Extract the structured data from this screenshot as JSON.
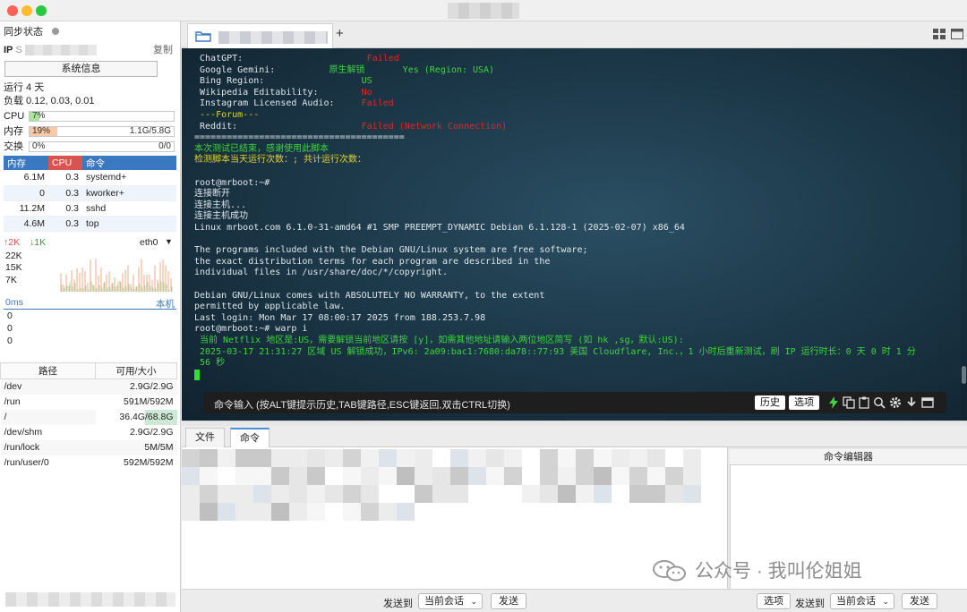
{
  "sidebar": {
    "sync_label": "同步状态",
    "ip_label": "IP",
    "ip_value_prefix": "S",
    "copy_label": "复制",
    "sysinfo_button": "系统信息",
    "uptime": "运行 4 天",
    "load": "负载 0.12, 0.03, 0.01",
    "cpu": {
      "label": "CPU",
      "percent_text": "7%",
      "fraction": 0.07,
      "value": ""
    },
    "mem": {
      "label": "内存",
      "percent_text": "19%",
      "fraction": 0.19,
      "value": "1.1G/5.8G"
    },
    "swap": {
      "label": "交换",
      "percent_text": "0%",
      "fraction": 0.0,
      "value": "0/0"
    },
    "proc_headers": {
      "mem": "内存",
      "cpu": "CPU",
      "cmd": "命令"
    },
    "processes": [
      {
        "mem": "6.1M",
        "cpu": "0.3",
        "cmd": "systemd+"
      },
      {
        "mem": "0",
        "cpu": "0.3",
        "cmd": "kworker+"
      },
      {
        "mem": "11.2M",
        "cpu": "0.3",
        "cmd": "sshd"
      },
      {
        "mem": "4.6M",
        "cpu": "0.3",
        "cmd": "top"
      }
    ],
    "net": {
      "up": "2K",
      "down": "1K",
      "iface": "eth0",
      "ticks": [
        "22K",
        "15K",
        "7K"
      ]
    },
    "latency": {
      "label": "0ms",
      "host": "本机",
      "values": [
        "0",
        "0",
        "0"
      ]
    },
    "disk_headers": {
      "path": "路径",
      "usage": "可用/大小"
    },
    "disks": [
      {
        "path": "/dev",
        "usage": "2.9G/2.9G"
      },
      {
        "path": "/run",
        "usage": "591M/592M"
      },
      {
        "path": "/",
        "usage": "36.4G/68.8G"
      },
      {
        "path": "/dev/shm",
        "usage": "2.9G/2.9G"
      },
      {
        "path": "/run/lock",
        "usage": "5M/5M"
      },
      {
        "path": "/run/user/0",
        "usage": "592M/592M"
      }
    ]
  },
  "tabs": {
    "add": "+",
    "close": "×"
  },
  "terminal": {
    "lines": [
      {
        "t": " ChatGPT:                       ",
        "r": "Failed",
        "rc": "red"
      },
      {
        "t": " Google Gemini:          ",
        "m": "原生解锁",
        "mc": "green",
        "t2": "       ",
        "r": "Yes (Region: USA)",
        "rc": "green"
      },
      {
        "t": " Bing Region:                  ",
        "r": "US",
        "rc": "green"
      },
      {
        "t": " Wikipedia Editability:        ",
        "r": "No",
        "rc": "red"
      },
      {
        "t": " Instagram Licensed Audio:     ",
        "r": "Failed",
        "rc": "red"
      },
      {
        "t": "",
        "r": " ---Forum---",
        "rc": "yellow"
      },
      {
        "t": " Reddit:                       ",
        "r": "Failed (Network Connection)",
        "rc": "red"
      },
      {
        "t": "=======================================",
        "r": "",
        "rc": "white"
      },
      {
        "t": "",
        "r": "本次测试已结束，感谢使用此脚本",
        "rc": "green"
      },
      {
        "t": "",
        "r": "检测脚本当天运行次数：; 共计运行次数：",
        "rc": "yellow"
      },
      {
        "t": "",
        "r": "",
        "rc": "white"
      },
      {
        "t": "root@mrboot:~#",
        "r": "",
        "rc": "white"
      },
      {
        "t": "连接断开",
        "r": "",
        "rc": "white"
      },
      {
        "t": "连接主机...",
        "r": "",
        "rc": "white"
      },
      {
        "t": "连接主机成功",
        "r": "",
        "rc": "white"
      },
      {
        "t": "Linux mrboot.com 6.1.0-31-amd64 #1 SMP PREEMPT_DYNAMIC Debian 6.1.128-1 (2025-02-07) x86_64",
        "r": "",
        "rc": "white"
      },
      {
        "t": "",
        "r": "",
        "rc": "white"
      },
      {
        "t": "The programs included with the Debian GNU/Linux system are free software;",
        "r": "",
        "rc": "white"
      },
      {
        "t": "the exact distribution terms for each program are described in the",
        "r": "",
        "rc": "white"
      },
      {
        "t": "individual files in /usr/share/doc/*/copyright.",
        "r": "",
        "rc": "white"
      },
      {
        "t": "",
        "r": "",
        "rc": "white"
      },
      {
        "t": "Debian GNU/Linux comes with ABSOLUTELY NO WARRANTY, to the extent",
        "r": "",
        "rc": "white"
      },
      {
        "t": "permitted by applicable law.",
        "r": "",
        "rc": "white"
      },
      {
        "t": "Last login: Mon Mar 17 08:00:17 2025 from 188.253.7.98",
        "r": "",
        "rc": "white"
      },
      {
        "t": "root@mrboot:~# warp i",
        "r": "",
        "rc": "white"
      },
      {
        "t": "",
        "r": " 当前 Netflix 地区是:US，需要解锁当前地区请按 [y]，如需其他地址请输入两位地区简写 (如 hk ,sg，默认:US):",
        "rc": "green"
      },
      {
        "t": "",
        "r": " 2025-03-17 21:31:27 区域 US 解锁成功，IPv6: 2a09:bac1:7680:da78::77:93 美国 Cloudflare, Inc.，1 小时后重新测试，刷 IP 运行时长：0 天 0 时 1 分",
        "rc": "green"
      },
      {
        "t": "",
        "r": " 56 秒",
        "rc": "green"
      }
    ],
    "cmd_placeholder": "命令输入 (按ALT键提示历史,TAB键路径,ESC键返回,双击CTRL切换)",
    "history_button": "历史",
    "options_button": "选项"
  },
  "bottom_tabs": {
    "files": "文件",
    "commands": "命令"
  },
  "editor_title": "命令编辑器",
  "bottom_bar": {
    "send_to": "发送到",
    "session": "当前会话",
    "send": "发送",
    "options": "选项"
  },
  "watermark": "公众号 · 我叫伦姐姐",
  "colors": {
    "accent": "#4a90d9",
    "proc_header": "#3b78c2",
    "cpu_header": "#d9534f",
    "terminal_green": "#3fd43f",
    "terminal_red": "#e0281f",
    "terminal_yellow": "#e4d424"
  }
}
